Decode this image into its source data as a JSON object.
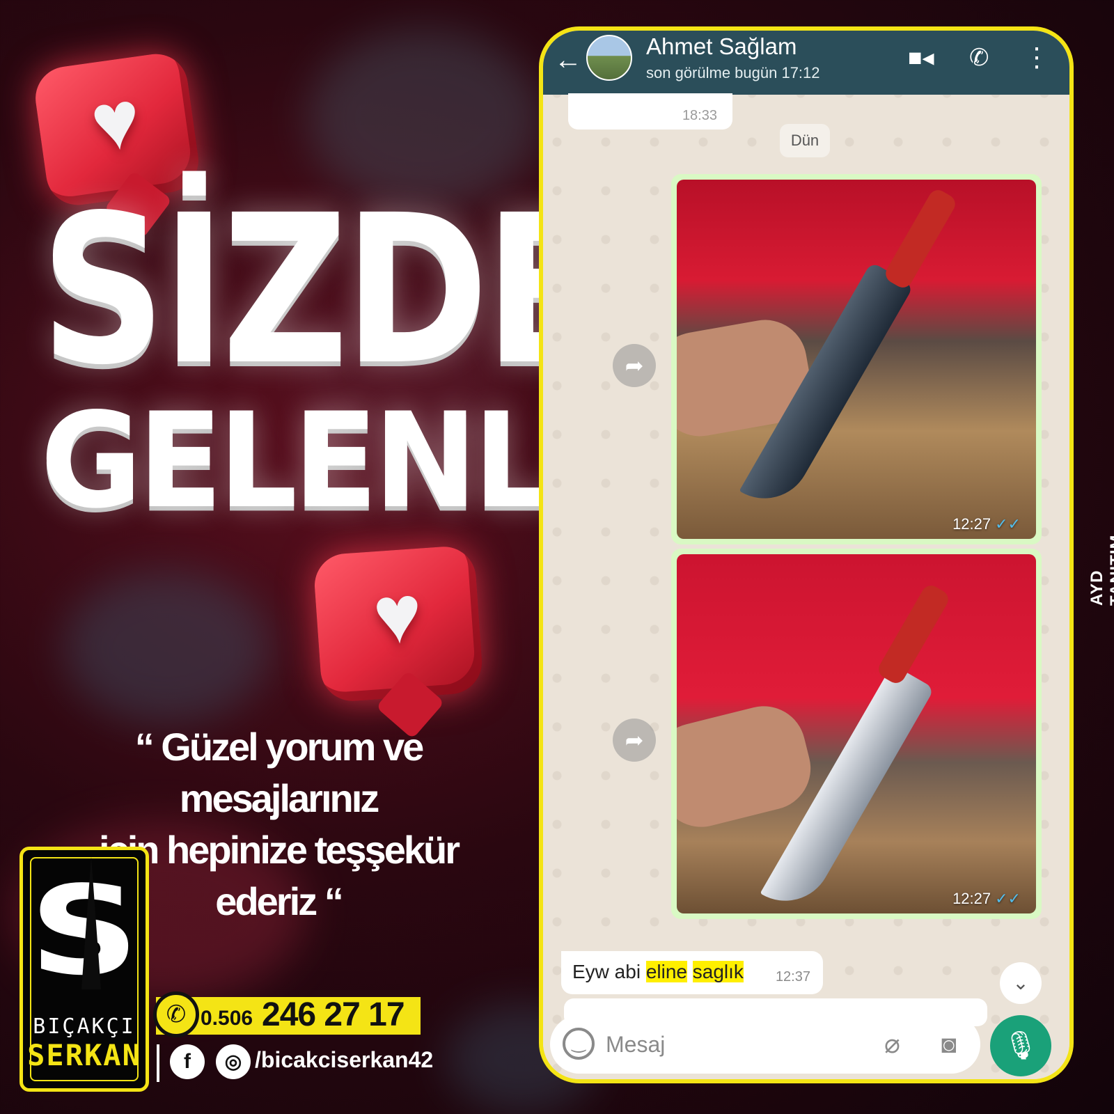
{
  "colors": {
    "accent_yellow": "#f4e415",
    "whatsapp_header": "#2b4e5a",
    "whatsapp_green": "#1aa179",
    "bubble_out": "#d9f9c4",
    "highlight": "#ffef00"
  },
  "poster": {
    "title_line1": "SİZDEN",
    "title_line2": "GELENLER",
    "thanks_line1": "“ Güzel yorum ve mesajlarınız",
    "thanks_line2": "için hepinize teşşekür ederiz “",
    "watermark": "AYD TANITIM"
  },
  "brand": {
    "logo_mark": "S",
    "name_line1": "BIÇAKÇI",
    "name_line2": "SERKAN",
    "phone_prefix": "0.506",
    "phone_main": "246 27 17",
    "social_handle": "/bicakciserkan42",
    "icons": [
      "whatsapp-icon",
      "facebook-icon",
      "instagram-icon"
    ]
  },
  "chat": {
    "contact_name": "Ahmet Sağlam",
    "last_seen": "son görülme bugün 17:12",
    "previous_time": "18:33",
    "date_divider": "Dün",
    "images": [
      {
        "time": "12:27",
        "status": "read"
      },
      {
        "time": "12:27",
        "status": "read"
      }
    ],
    "message": {
      "part1": "Eyw abi ",
      "highlight1": "eline",
      "space": " ",
      "highlight2": "saglık",
      "time": "12:37"
    },
    "composer_placeholder": "Mesaj",
    "icons": {
      "back": "back-arrow-icon",
      "video": "video-call-icon",
      "call": "phone-call-icon",
      "menu": "more-vert-icon"
    }
  }
}
